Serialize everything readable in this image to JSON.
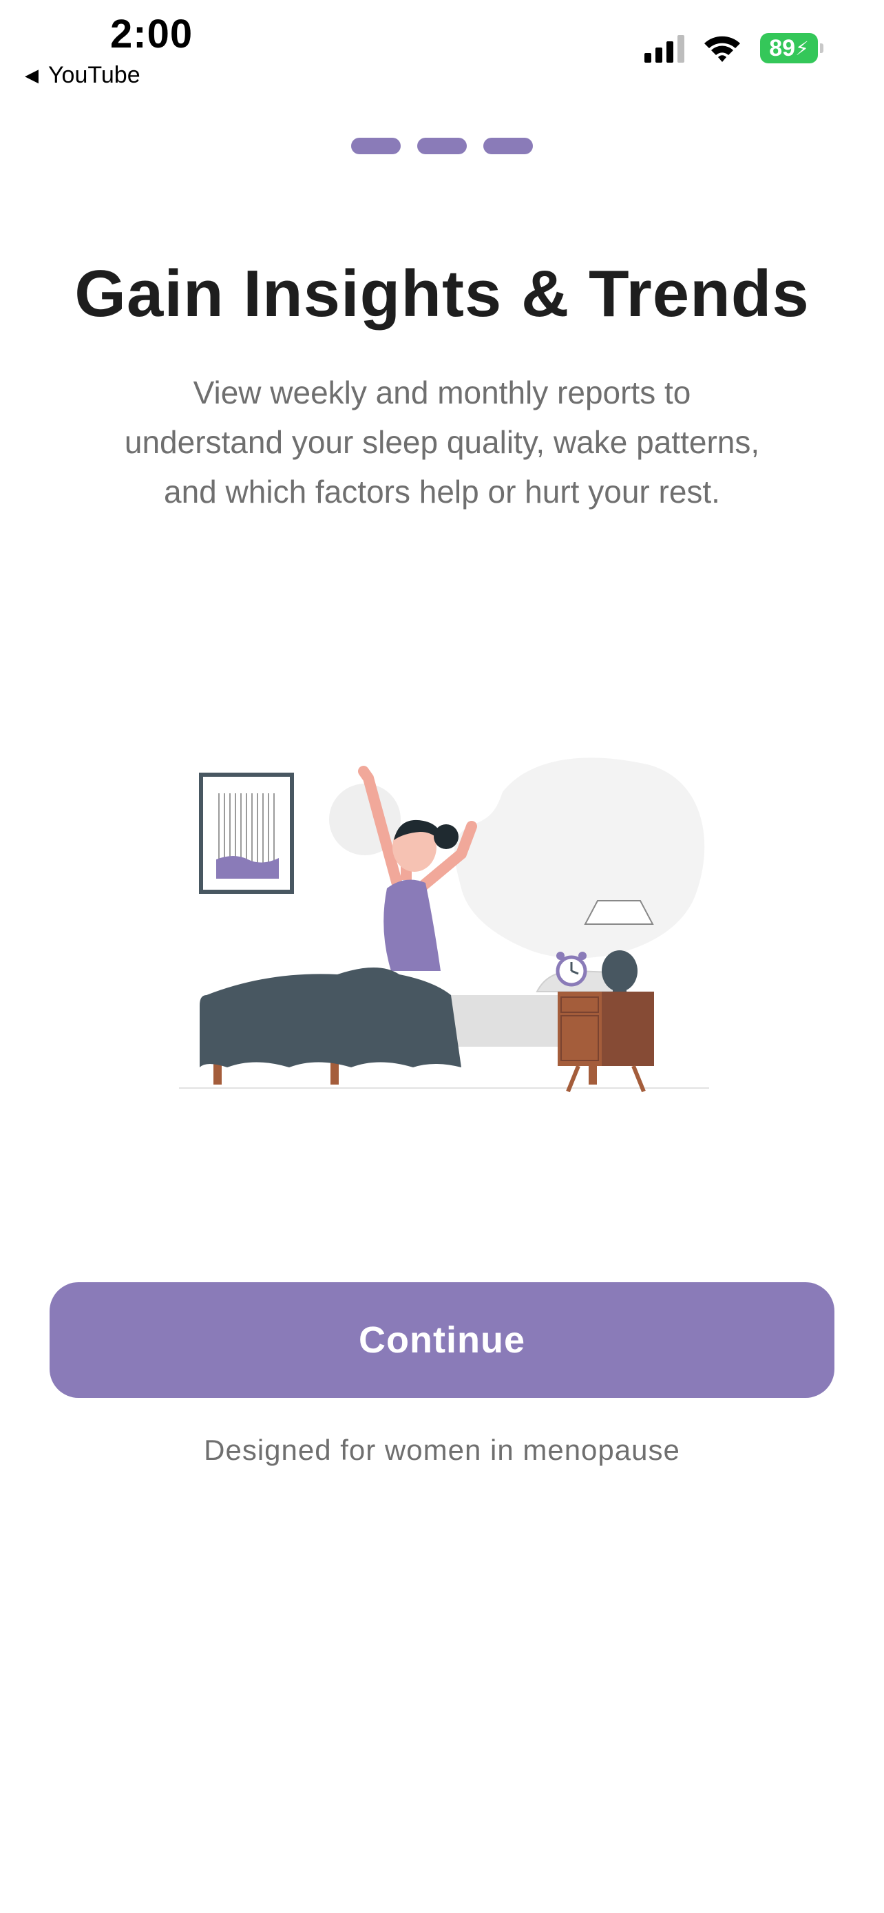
{
  "status_bar": {
    "time": "2:00",
    "back_app": "YouTube",
    "battery": "89"
  },
  "onboarding": {
    "page_count": 3,
    "title": "Gain Insights & Trends",
    "description": "View weekly and monthly reports to understand your sleep quality, wake patterns, and which factors help or hurt your rest.",
    "continue_label": "Continue",
    "footnote": "Designed for women in menopause"
  },
  "colors": {
    "accent": "#8a7bb8",
    "title_text": "#1e1e1e",
    "body_text": "#6f6f6f",
    "battery": "#34c759"
  },
  "illustration": {
    "icon": "woman-waking-up-in-bed-illustration"
  }
}
